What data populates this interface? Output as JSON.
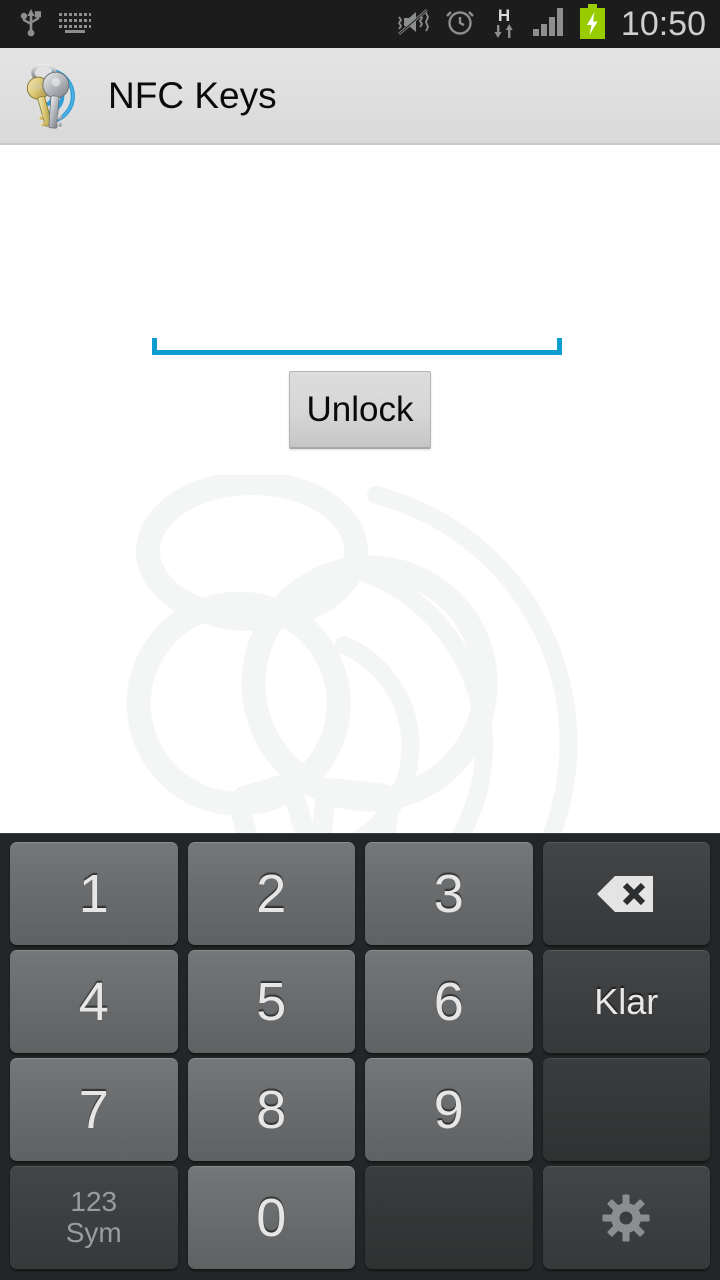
{
  "statusbar": {
    "time": "10:50",
    "left_icons": [
      {
        "name": "usb-icon",
        "label": "USB connected"
      },
      {
        "name": "keyboard-icon",
        "label": "Input method"
      }
    ],
    "right_icons": [
      {
        "name": "vibrate-mute-icon",
        "label": "Sound muted / vibrate"
      },
      {
        "name": "alarm-clock-icon",
        "label": "Alarm set"
      },
      {
        "name": "hspa-data-icon",
        "label": "H data transfer"
      },
      {
        "name": "signal-bars-icon",
        "label": "Signal strength"
      },
      {
        "name": "battery-charging-icon",
        "label": "Battery charging"
      }
    ],
    "network_type": "H",
    "colors": {
      "background": "#1c1c1c",
      "icon": "#8c8e90",
      "text": "#cfcfcf",
      "battery": "#99cc00"
    }
  },
  "titlebar": {
    "title": "NFC Keys",
    "icon": "nfc-keys-app-icon",
    "colors": {
      "background": "#dedede",
      "text": "#0a0a0a",
      "divider": "#c9c9c9"
    }
  },
  "main": {
    "password_field": {
      "value": "",
      "placeholder": "",
      "underline_color": "#0d9dd0"
    },
    "unlock_button": {
      "label": "Unlock"
    },
    "watermark": {
      "name": "nfc-keys-watermark",
      "opacity": "0.085"
    }
  },
  "keyboard": {
    "language": "sv",
    "rows": [
      [
        {
          "name": "key-1",
          "type": "num",
          "label": "1"
        },
        {
          "name": "key-2",
          "type": "num",
          "label": "2"
        },
        {
          "name": "key-3",
          "type": "num",
          "label": "3"
        },
        {
          "name": "key-backspace",
          "type": "fn",
          "label": "",
          "icon": "backspace-icon"
        }
      ],
      [
        {
          "name": "key-4",
          "type": "num",
          "label": "4"
        },
        {
          "name": "key-5",
          "type": "num",
          "label": "5"
        },
        {
          "name": "key-6",
          "type": "num",
          "label": "6"
        },
        {
          "name": "key-done",
          "type": "fn",
          "label": "Klar"
        }
      ],
      [
        {
          "name": "key-7",
          "type": "num",
          "label": "7"
        },
        {
          "name": "key-8",
          "type": "num",
          "label": "8"
        },
        {
          "name": "key-9",
          "type": "num",
          "label": "9"
        },
        {
          "name": "key-blank-right",
          "type": "blank",
          "label": ""
        }
      ],
      [
        {
          "name": "key-symbols",
          "type": "fn",
          "label": "",
          "label_top": "123",
          "label_bottom": "Sym"
        },
        {
          "name": "key-0",
          "type": "num",
          "label": "0"
        },
        {
          "name": "key-blank-bottom",
          "type": "blank",
          "label": ""
        },
        {
          "name": "key-settings",
          "type": "fn",
          "label": "",
          "icon": "gear-icon"
        }
      ]
    ],
    "colors": {
      "background": "#232527",
      "num_key": "#6a6c6e",
      "fn_key": "#3c3e40",
      "blank_key": "#343637",
      "key_text": "#e6e6e6",
      "dim_text": "#9a9c9e"
    }
  }
}
